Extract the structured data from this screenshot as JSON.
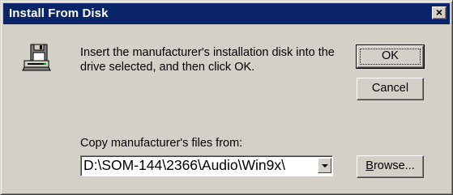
{
  "window": {
    "title": "Install From Disk"
  },
  "icons": {
    "disk": "floppy-drive-icon",
    "close": "close-icon"
  },
  "message": "Insert the manufacturer's installation disk into the drive selected, and then click OK.",
  "buttons": {
    "ok": "OK",
    "cancel": "Cancel",
    "browse": "Browse...",
    "close": "×"
  },
  "copy": {
    "label": "Copy manufacturer's files from:",
    "value": "D:\\SOM-144\\2366\\Audio\\Win9x\\"
  },
  "colors": {
    "titlebar": "#0a246a",
    "face": "#d4d0c8"
  }
}
